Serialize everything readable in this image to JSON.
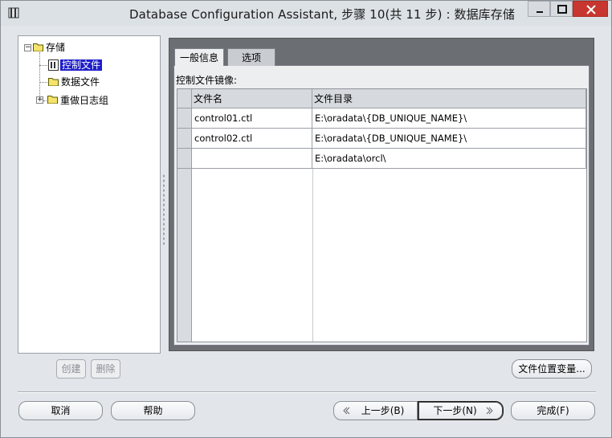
{
  "window": {
    "title": "Database Configuration Assistant, 步骤 10(共 11 步) : 数据库存储"
  },
  "tree": {
    "root": "存储",
    "items": [
      {
        "label": "控制文件",
        "selected": true
      },
      {
        "label": "数据文件",
        "selected": false
      },
      {
        "label": "重做日志组",
        "selected": false,
        "expandable": true
      }
    ]
  },
  "tree_buttons": {
    "create": "创建",
    "delete": "删除"
  },
  "tabs": [
    {
      "label": "一般信息",
      "active": true
    },
    {
      "label": "选项",
      "active": false
    }
  ],
  "control_files": {
    "section_label": "控制文件镜像:",
    "columns": [
      "文件名",
      "文件目录"
    ],
    "rows": [
      {
        "name": "control01.ctl",
        "dir": "E:\\oradata\\{DB_UNIQUE_NAME}\\"
      },
      {
        "name": "control02.ctl",
        "dir": "E:\\oradata\\{DB_UNIQUE_NAME}\\"
      },
      {
        "name": "",
        "dir": "E:\\oradata\\orcl\\"
      }
    ]
  },
  "file_location_button": "文件位置变量...",
  "footer": {
    "cancel": "取消",
    "help": "帮助",
    "back": "上一步(B)",
    "next": "下一步(N)",
    "finish": "完成(F)"
  }
}
